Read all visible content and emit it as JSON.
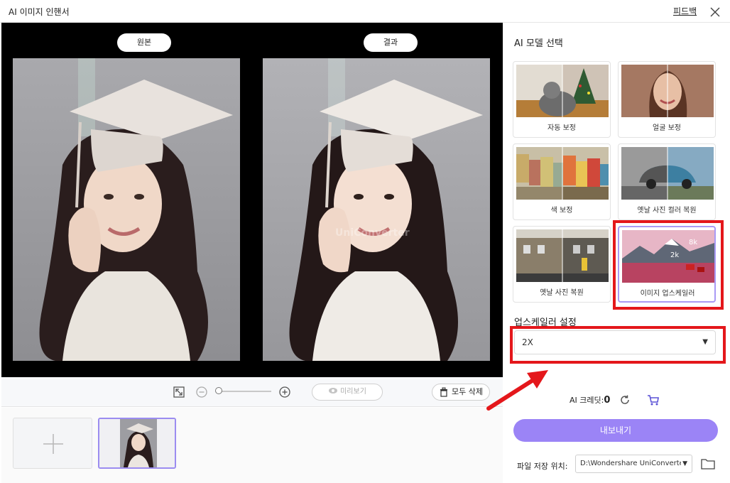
{
  "window": {
    "title": "AI 이미지 인핸서",
    "feedback": "피드백",
    "close_icon": "close-icon"
  },
  "preview": {
    "original_label": "원본",
    "result_label": "결과",
    "watermark": "UniConverter"
  },
  "toolbar": {
    "fit_icon": "fit-screen-icon",
    "zoom_out_icon": "zoom-out-icon",
    "zoom_in_icon": "zoom-in-icon",
    "preview_label": "미리보기",
    "delete_all_label": "모두 삭제"
  },
  "panel": {
    "model_heading": "AI 모델 선택",
    "models": [
      {
        "label": "자동 보정"
      },
      {
        "label": "얼굴 보정"
      },
      {
        "label": "색 보정"
      },
      {
        "label": "옛날 사진 컬러 복원"
      },
      {
        "label": "옛날 사진 복원"
      },
      {
        "label": "이미지 업스케일러",
        "badges": [
          "8k",
          "2k"
        ]
      }
    ],
    "selected_model": "이미지 업스케일러",
    "upscaler_heading": "업스케일러 설정",
    "upscale_value": "2X",
    "credits_label": "AI 크레딧:",
    "credits_value": "0",
    "export_label": "내보내기",
    "save_location_label": "파일 저장 위치:",
    "save_path": "D:\\Wondershare UniConverter"
  },
  "colors": {
    "accent": "#9b84f6",
    "highlight": "#e4171b",
    "preview_bg": "#000000"
  }
}
